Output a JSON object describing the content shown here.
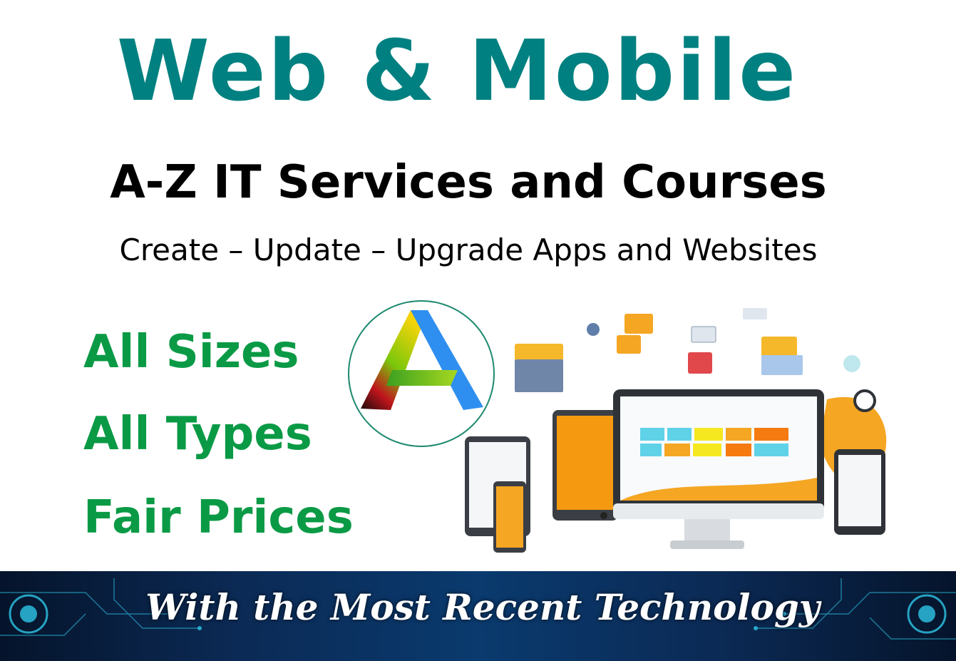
{
  "header": {
    "title": "Web & Mobile",
    "subtitle": "A-Z IT Services and Courses",
    "tagline": "Create – Update – Upgrade Apps and Websites"
  },
  "features": [
    "All Sizes",
    "All Types",
    "Fair Prices"
  ],
  "banner": {
    "text": "With the Most Recent Technology"
  },
  "colors": {
    "title": "#008080",
    "subtitle": "#000000",
    "feature": "#0a9a45",
    "banner_bg": "#0b2a55",
    "logo_blue": "#2f8ff0",
    "logo_green": "#7ac70b",
    "logo_red": "#c0151d",
    "accent_orange": "#f59a10"
  },
  "icons": {
    "logo": "letter-a-logo",
    "illustration": "responsive-devices-illustration"
  }
}
